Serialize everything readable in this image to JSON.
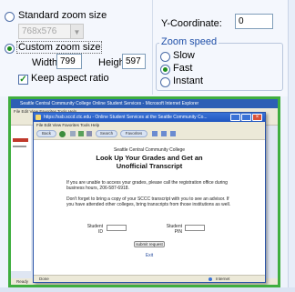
{
  "zoom_size": {
    "standard_label": "Standard zoom size",
    "standard_value": "768x576",
    "custom_label": "Custom zoom size",
    "width_label": "Width:",
    "width_value": "799",
    "height_label": "Height:",
    "height_value": "597",
    "keep_aspect_label": "Keep aspect ratio",
    "selected": "custom",
    "keep_aspect_checked": true
  },
  "coordinates": {
    "y_label": "Y-Coordinate:",
    "y_value": "0"
  },
  "zoom_speed": {
    "legend": "Zoom speed",
    "options": [
      "Slow",
      "Fast",
      "Instant"
    ],
    "selected": "Fast"
  },
  "preview": {
    "background_title": "Seattle Central Community College Online Student Services - Microsoft Internet Explorer",
    "window_title": "https://ssb.sccd.ctc.edu - Online Student Services at the Seattle Community Co...",
    "menu": "File   Edit   View   Favorites   Tools   Help",
    "toolbar": {
      "back": "Back",
      "search": "Search",
      "favorites": "Favorites"
    },
    "college": "Seattle Central Community College",
    "heading_line1": "Look Up Your Grades and Get an",
    "heading_line2": "Unofficial Transcript",
    "para1": "If you are unable to access your grades, please call the registration office during business hours, 206-587-6918.",
    "para2": "Don't forget to bring a copy of your SCCC transcript with you to see an advisor. If you have attended other colleges, bring transcripts from those institutions as well.",
    "student_id_label": "Student ID",
    "student_pin_label": "Student PIN",
    "submit_label": "submit request",
    "exit_label": "Exit",
    "status_done": "Done",
    "status_zone": "Internet",
    "bg_status": "Ready"
  },
  "colors": {
    "accent_green": "#3fae3f",
    "legend_blue": "#1f4fa8",
    "titlebar_blue": "#2056c0"
  }
}
